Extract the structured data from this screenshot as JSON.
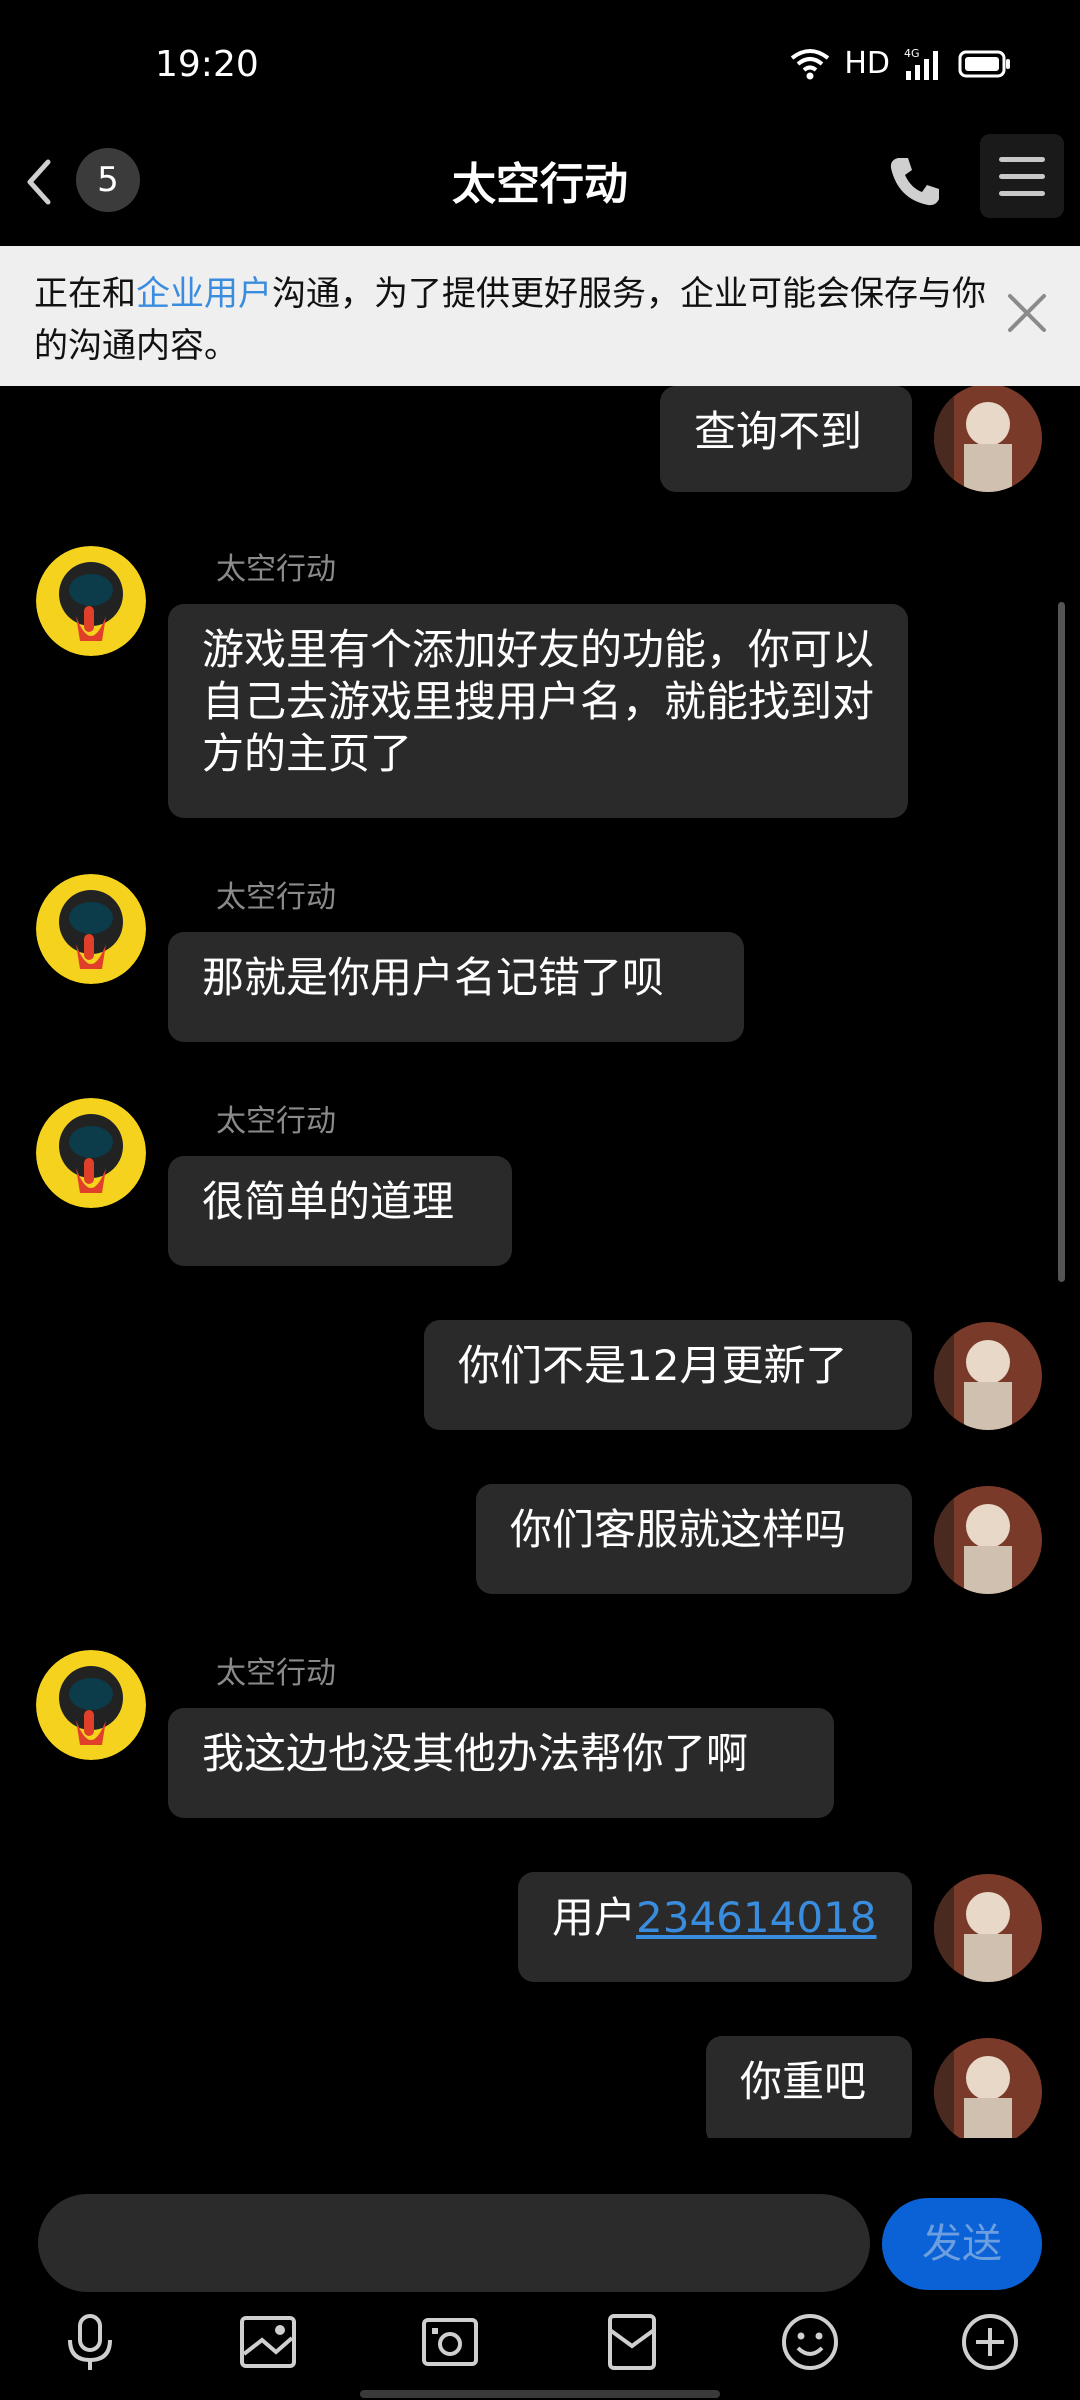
{
  "status_bar": {
    "time": "19:20",
    "network": "HD"
  },
  "header": {
    "unread_count": "5",
    "title": "太空行动"
  },
  "notice": {
    "prefix": "正在和",
    "highlight": "企业用户",
    "suffix": "沟通，为了提供更好服务，企业可能会保存与你的沟通内容。"
  },
  "messages": [
    {
      "side": "right",
      "text": "查询不到"
    },
    {
      "side": "left",
      "sender": "太空行动",
      "text": "游戏里有个添加好友的功能，你可以自己去游戏里搜用户名，就能找到对方的主页了"
    },
    {
      "side": "left",
      "sender": "太空行动",
      "text": "那就是你用户名记错了呗"
    },
    {
      "side": "left",
      "sender": "太空行动",
      "text": "很简单的道理"
    },
    {
      "side": "right",
      "text": "你们不是12月更新了"
    },
    {
      "side": "right",
      "text": "你们客服就这样吗"
    },
    {
      "side": "left",
      "sender": "太空行动",
      "text": "我这边也没其他办法帮你了啊"
    },
    {
      "side": "right",
      "text_prefix": "用户",
      "link": "234614018"
    },
    {
      "side": "right",
      "text": "你重吧"
    }
  ],
  "compose": {
    "send_label": "发送"
  },
  "toolbar": {
    "icons": [
      "microphone-icon",
      "image-icon",
      "camera-icon",
      "red-packet-icon",
      "emoji-icon",
      "plus-icon"
    ]
  },
  "colors": {
    "accent": "#3a8dde",
    "send_button": "#0a62d6",
    "bubble": "#2a2a2a",
    "background": "#000000"
  }
}
